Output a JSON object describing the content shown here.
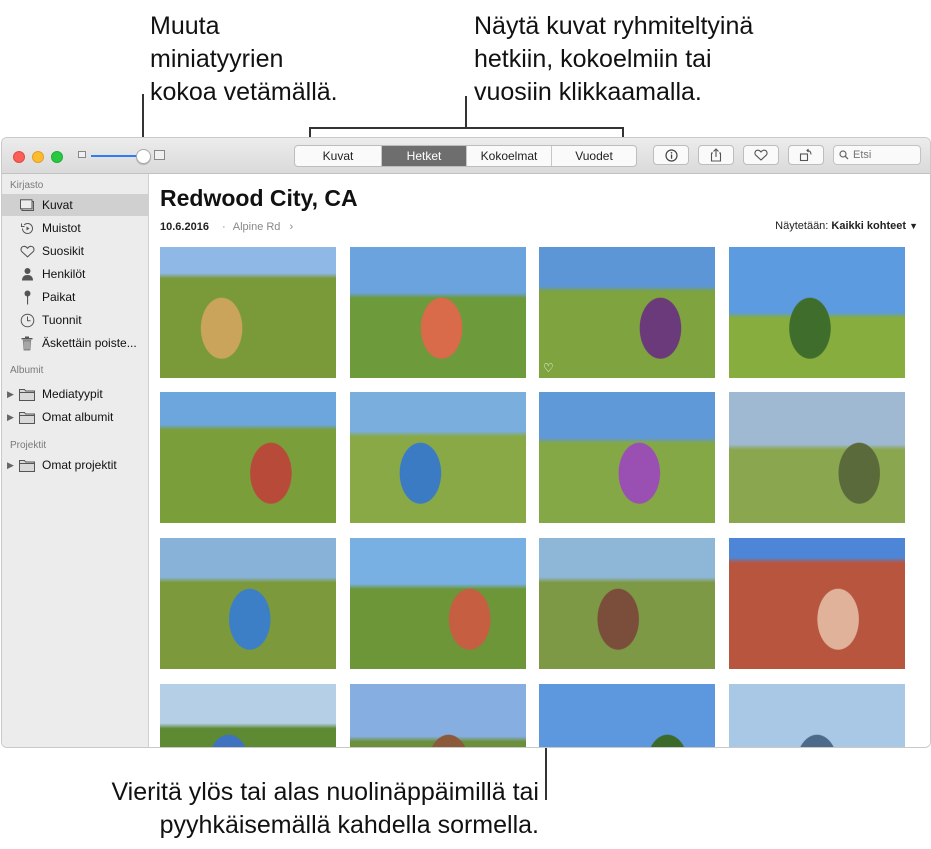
{
  "callouts": {
    "top_left": [
      "Muuta",
      "miniatyyrien",
      "kokoa vetämällä."
    ],
    "top_right": [
      "Näytä kuvat ryhmiteltyinä",
      "hetkiin, kokoelmiin tai",
      "vuosiin klikkaamalla."
    ],
    "bottom": [
      "Vieritä ylös tai alas nuolinäppäimillä tai",
      "pyyhkäisemällä kahdella sormella."
    ]
  },
  "toolbar": {
    "view_tabs": [
      {
        "label": "Kuvat",
        "active": false
      },
      {
        "label": "Hetket",
        "active": true
      },
      {
        "label": "Kokoelmat",
        "active": false
      },
      {
        "label": "Vuodet",
        "active": false
      }
    ],
    "search_placeholder": "Etsi",
    "icons": [
      "info-icon",
      "share-icon",
      "heart-icon",
      "rotate-icon"
    ]
  },
  "sidebar": {
    "sections": [
      {
        "title": "Kirjasto",
        "items": [
          {
            "label": "Kuvat",
            "icon": "photos-icon",
            "selected": true
          },
          {
            "label": "Muistot",
            "icon": "memories-icon"
          },
          {
            "label": "Suosikit",
            "icon": "heart-icon"
          },
          {
            "label": "Henkilöt",
            "icon": "person-icon"
          },
          {
            "label": "Paikat",
            "icon": "pin-icon"
          },
          {
            "label": "Tuonnit",
            "icon": "clock-icon"
          },
          {
            "label": "Äskettäin poiste...",
            "icon": "trash-icon"
          }
        ]
      },
      {
        "title": "Albumit",
        "items": [
          {
            "label": "Mediatyypit",
            "icon": "folder-icon"
          },
          {
            "label": "Omat albumit",
            "icon": "folder-icon"
          }
        ]
      },
      {
        "title": "Projektit",
        "items": [
          {
            "label": "Omat projektit",
            "icon": "folder-icon"
          }
        ]
      }
    ]
  },
  "main": {
    "title": "Redwood City, CA",
    "date": "10.6.2016",
    "separator": "·",
    "location": "Alpine Rd",
    "showing_label": "Näytetään:",
    "showing_value": "Kaikki kohteet",
    "photos": [
      {
        "sky": "#8fb8e6",
        "ground": "#7a9a3a",
        "accent": "#c9a45a",
        "horizon": 0.2
      },
      {
        "sky": "#6aa3dd",
        "ground": "#6d9a3b",
        "accent": "#d96a4a",
        "horizon": 0.35
      },
      {
        "sky": "#5d96d6",
        "ground": "#7ea33f",
        "accent": "#6b3a7a",
        "horizon": 0.3,
        "favorite": true
      },
      {
        "sky": "#5c9be0",
        "ground": "#86ad3e",
        "accent": "#3f6e2c",
        "horizon": 0.5
      },
      {
        "sky": "#6da6dc",
        "ground": "#7a9e3a",
        "accent": "#b84a3a",
        "horizon": 0.25
      },
      {
        "sky": "#7aaedc",
        "ground": "#89a946",
        "accent": "#3b7bc4",
        "horizon": 0.3
      },
      {
        "sky": "#5f99d8",
        "ground": "#84a845",
        "accent": "#9a4fb3",
        "horizon": 0.35
      },
      {
        "sky": "#9fb9d3",
        "ground": "#8aa750",
        "accent": "#5a6a3a",
        "horizon": 0.4
      },
      {
        "sky": "#88b2d8",
        "ground": "#7c9a3c",
        "accent": "#3d7fc6",
        "horizon": 0.3
      },
      {
        "sky": "#78b0e4",
        "ground": "#6c9638",
        "accent": "#c65e42",
        "horizon": 0.35
      },
      {
        "sky": "#8eb6d6",
        "ground": "#7e9945",
        "accent": "#7a4e3a",
        "horizon": 0.3
      },
      {
        "sky": "#4d86d6",
        "ground": "#b8553f",
        "accent": "#e0b29a",
        "horizon": 0.15
      },
      {
        "sky": "#b5cfe6",
        "ground": "#5d8a33",
        "accent": "#3f72c0",
        "horizon": 0.3
      },
      {
        "sky": "#86aee0",
        "ground": "#6b8f3a",
        "accent": "#8a5a3a",
        "horizon": 0.4
      },
      {
        "sky": "#5d97dd",
        "ground": "#4f7d2c",
        "accent": "#3c6a2a",
        "horizon": 0.55
      },
      {
        "sky": "#a9c8e6",
        "ground": "#6a8e7a",
        "accent": "#4d6a8a",
        "horizon": 0.5
      }
    ]
  },
  "colors": {
    "close": "#fc5f57",
    "minimize": "#fdbc2e",
    "zoom": "#28c940",
    "slider_accent": "#2f7cf6",
    "active_tab": "#6e6e6e"
  }
}
